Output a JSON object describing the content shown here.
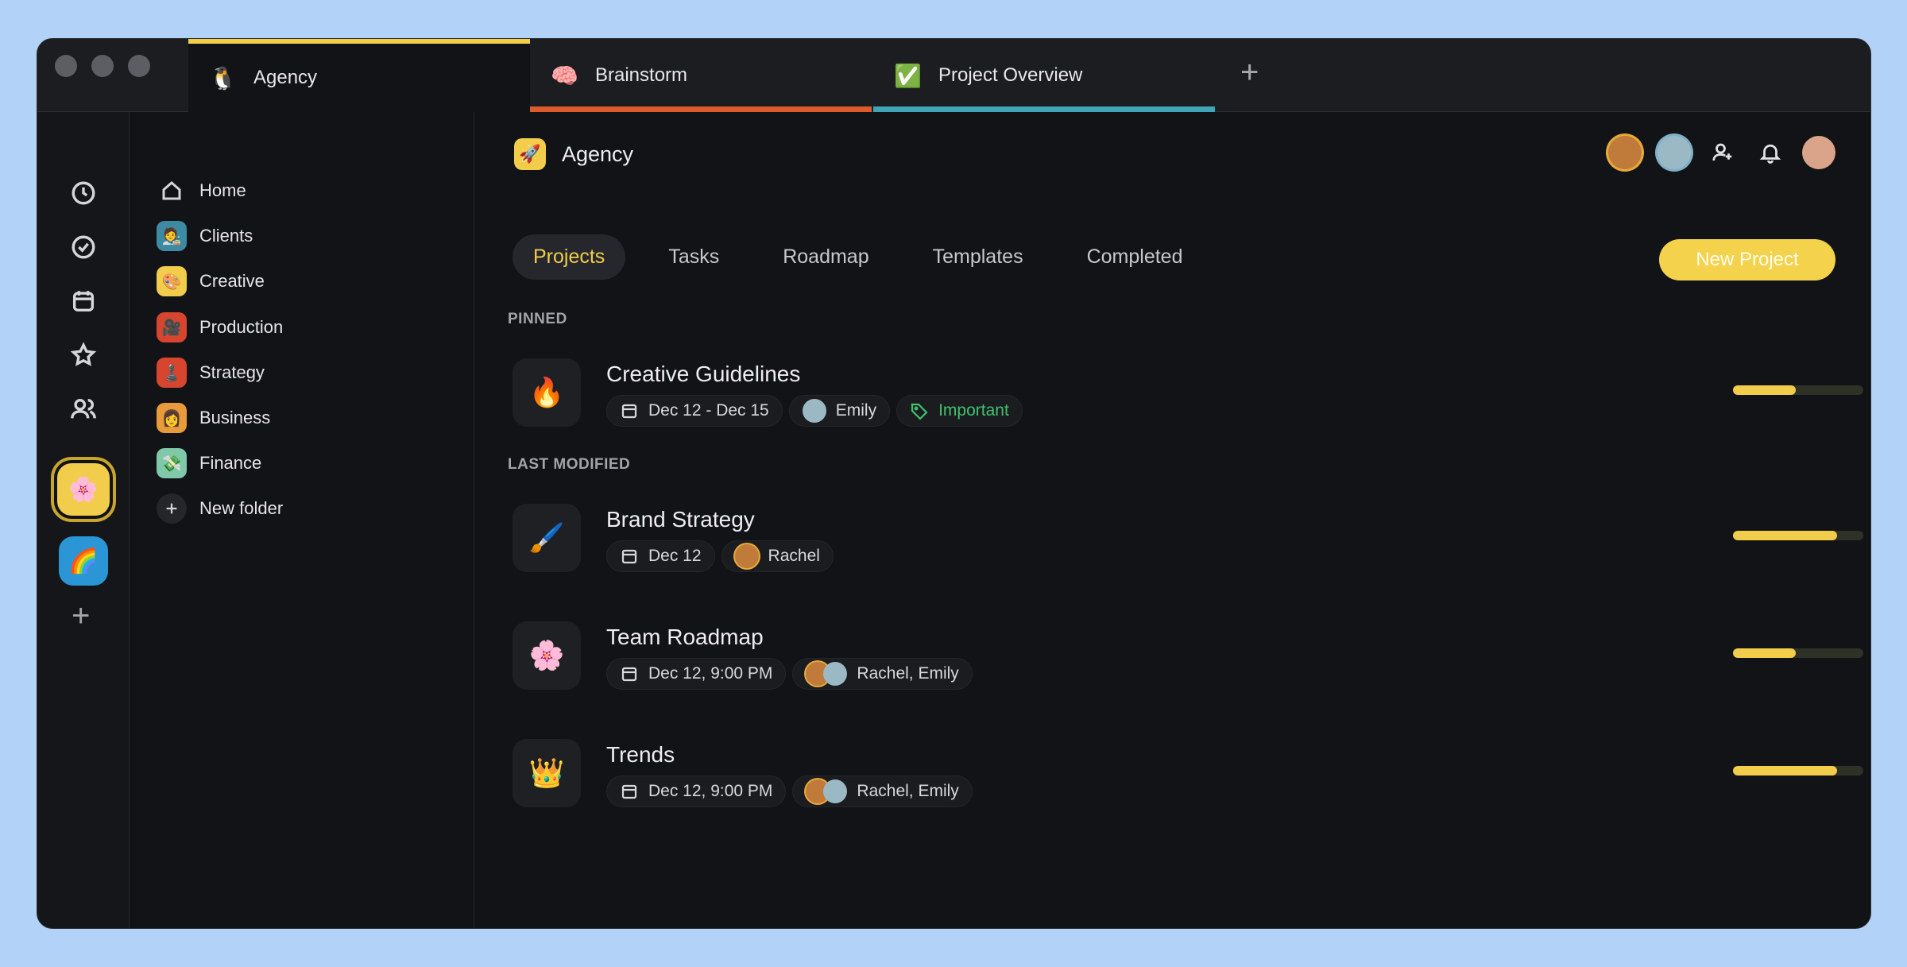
{
  "tabs": [
    {
      "label": "Agency",
      "icon": "🐧",
      "underline": "#f2cd4b"
    },
    {
      "label": "Brainstorm",
      "icon": "🧠",
      "underline": "#dd5a2c"
    },
    {
      "label": "Project Overview",
      "icon": "✅",
      "underline": "#3fa6b8"
    }
  ],
  "folders": [
    {
      "label": "Home",
      "icon": "home-icon",
      "bg": "transparent"
    },
    {
      "label": "Clients",
      "icon": "🧑‍🎨",
      "bg": "#3d8aa3"
    },
    {
      "label": "Creative",
      "icon": "🎨",
      "bg": "#f2cd4b"
    },
    {
      "label": "Production",
      "icon": "🎥",
      "bg": "#d8452f"
    },
    {
      "label": "Strategy",
      "icon": "♟️",
      "bg": "#d8452f"
    },
    {
      "label": "Business",
      "icon": "👩",
      "bg": "#e99a3a"
    },
    {
      "label": "Finance",
      "icon": "💸",
      "bg": "#7fc9a9"
    },
    {
      "label": "New folder",
      "icon": "plus-icon",
      "bg": "#24262a"
    }
  ],
  "workspace": {
    "title": "Agency",
    "logo": "🚀"
  },
  "view_tabs": [
    "Projects",
    "Tasks",
    "Roadmap",
    "Templates",
    "Completed"
  ],
  "actions": {
    "new_project": "New Project"
  },
  "sections": {
    "pinned": "PINNED",
    "last_modified": "LAST MODIFIED"
  },
  "projects": [
    {
      "title": "Creative Guidelines",
      "icon": "🔥",
      "date": "Dec 12 - Dec 15",
      "people": "Emily",
      "tag": "Important",
      "progress": 0.48
    },
    {
      "title": "Brand Strategy",
      "icon": "🖌️",
      "date": "Dec 12",
      "people": "Rachel",
      "progress": 0.8
    },
    {
      "title": "Team Roadmap",
      "icon": "🌸",
      "date": "Dec 12, 9:00 PM",
      "people": "Rachel, Emily",
      "progress": 0.48
    },
    {
      "title": "Trends",
      "icon": "👑",
      "date": "Dec 12, 9:00 PM",
      "people": "Rachel, Emily",
      "progress": 0.8
    }
  ],
  "spaces": [
    "🌸",
    "🌈"
  ]
}
